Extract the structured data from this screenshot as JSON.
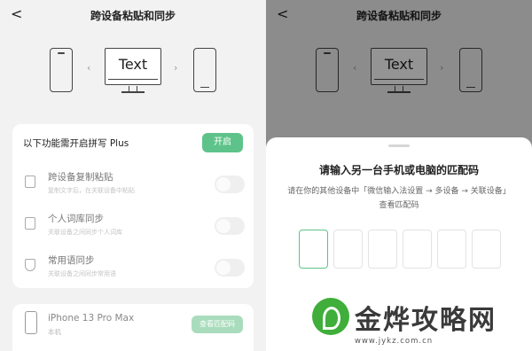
{
  "left": {
    "back_glyph": "<",
    "title": "跨设备粘贴和同步",
    "illustration": {
      "monitor_text": "Text",
      "left_arrow": "‹",
      "right_arrow": "›"
    },
    "card": {
      "heading": "以下功能需开启拼写 Plus",
      "open_button": "开启",
      "features": [
        {
          "icon": "clipboard-icon",
          "name": "跨设备复制粘贴",
          "desc": "复制文字后，在关联设备中粘贴"
        },
        {
          "icon": "book-icon",
          "name": "个人词库同步",
          "desc": "关联设备之间同步个人词库"
        },
        {
          "icon": "box-icon",
          "name": "常用语同步",
          "desc": "关联设备之间同步常用语"
        }
      ]
    },
    "device": {
      "name": "iPhone 13 Pro Max",
      "sub": "本机",
      "button": "查看匹配码"
    }
  },
  "right": {
    "back_glyph": "<",
    "title": "跨设备粘贴和同步",
    "illustration": {
      "monitor_text": "Text",
      "left_arrow": "‹",
      "right_arrow": "›"
    },
    "sheet": {
      "title": "请输入另一台手机或电脑的匹配码",
      "desc": "请在你的其他设备中「微信输入法设置 → 多设备 → 关联设备」查看匹配码"
    }
  },
  "watermark": {
    "text": "金烨攻略网",
    "url": "www.jykz.com.cn"
  },
  "colors": {
    "accent": "#5ec38a",
    "accent_light": "#a9dcbc"
  }
}
